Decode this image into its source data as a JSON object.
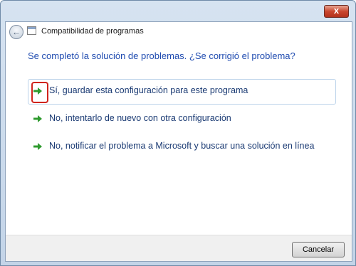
{
  "window": {
    "title": "Compatibilidad de programas",
    "close_label": "x"
  },
  "header": {
    "back_label": "←"
  },
  "main": {
    "question": "Se completó la solución de problemas. ¿Se corrigió el problema?",
    "options": [
      {
        "label": "Sí, guardar esta configuración para este programa",
        "icon": "green-arrow-icon",
        "selected": true,
        "highlighted": true
      },
      {
        "label": "No, intentarlo de nuevo con otra configuración",
        "icon": "green-arrow-icon",
        "selected": false
      },
      {
        "label": "No, notificar el problema a Microsoft y buscar una solución en línea",
        "icon": "green-arrow-icon",
        "selected": false
      }
    ]
  },
  "footer": {
    "cancel_label": "Cancelar"
  },
  "colors": {
    "accent": "#1f4bb0",
    "arrow": "#2e9a2e",
    "highlight": "#d0231c"
  }
}
